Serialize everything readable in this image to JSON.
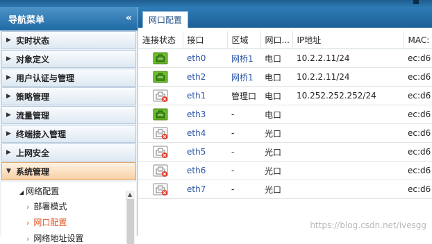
{
  "sidebar": {
    "title": "导航菜单",
    "collapse_icon": "«",
    "items": [
      {
        "label": "实时状态",
        "expanded": false
      },
      {
        "label": "对象定义",
        "expanded": false
      },
      {
        "label": "用户认证与管理",
        "expanded": false
      },
      {
        "label": "策略管理",
        "expanded": false
      },
      {
        "label": "流量管理",
        "expanded": false
      },
      {
        "label": "终端接入管理",
        "expanded": false
      },
      {
        "label": "上网安全",
        "expanded": false
      },
      {
        "label": "系统管理",
        "expanded": true
      }
    ],
    "submenu": {
      "parent": "网络配置",
      "items": [
        "部署模式",
        "网口配置",
        "网络地址设置"
      ],
      "current": "网口配置"
    }
  },
  "tab": {
    "label": "网口配置"
  },
  "table": {
    "headers": [
      "连接状态",
      "接口",
      "区域",
      "网口...",
      "IP地址",
      "MAC:"
    ],
    "rows": [
      {
        "connected": true,
        "interface": "eth0",
        "zone": "网桥1",
        "zone_link": true,
        "port_type": "电口",
        "ip": "10.2.2.11/24",
        "mac": "ec:d6"
      },
      {
        "connected": true,
        "interface": "eth2",
        "zone": "网桥1",
        "zone_link": true,
        "port_type": "电口",
        "ip": "10.2.2.11/24",
        "mac": "ec:d6"
      },
      {
        "connected": false,
        "interface": "eth1",
        "zone": "管理口",
        "zone_link": false,
        "port_type": "电口",
        "ip": "10.252.252.252/24",
        "mac": "ec:d6"
      },
      {
        "connected": true,
        "interface": "eth3",
        "zone": "-",
        "zone_link": false,
        "port_type": "电口",
        "ip": "",
        "mac": "ec:d6"
      },
      {
        "connected": false,
        "interface": "eth4",
        "zone": "-",
        "zone_link": false,
        "port_type": "光口",
        "ip": "",
        "mac": "ec:d6"
      },
      {
        "connected": false,
        "interface": "eth5",
        "zone": "-",
        "zone_link": false,
        "port_type": "光口",
        "ip": "",
        "mac": "ec:d6"
      },
      {
        "connected": false,
        "interface": "eth6",
        "zone": "-",
        "zone_link": false,
        "port_type": "光口",
        "ip": "",
        "mac": "ec:d6"
      },
      {
        "connected": false,
        "interface": "eth7",
        "zone": "-",
        "zone_link": false,
        "port_type": "光口",
        "ip": "",
        "mac": "ec:d6"
      }
    ]
  },
  "icons": {
    "connected": "ethernet-port-connected-icon",
    "disconnected": "ethernet-port-disconnected-icon"
  },
  "colors": {
    "port_connected": "#6cbf2c",
    "port_disconnected": "#e23b2b",
    "active_menu": "#f7cfa4",
    "current_subitem": "#e0531f",
    "link": "#2a55a5",
    "header_blue": "#1f6aa5"
  },
  "watermark": "https://blog.csdn.net/ivesgg"
}
